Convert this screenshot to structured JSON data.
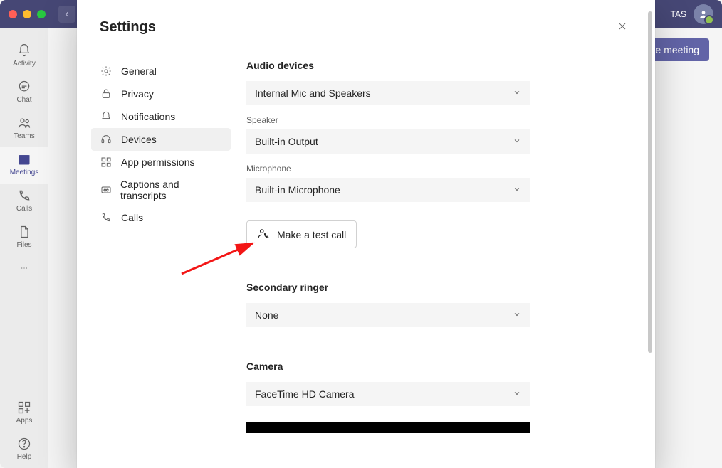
{
  "titlebar": {
    "user_initials": "TAS"
  },
  "leftnav": {
    "items": [
      {
        "label": "Activity"
      },
      {
        "label": "Chat"
      },
      {
        "label": "Teams"
      },
      {
        "label": "Meetings"
      },
      {
        "label": "Calls"
      },
      {
        "label": "Files"
      }
    ],
    "apps_label": "Apps",
    "help_label": "Help"
  },
  "mainbar": {
    "schedule_btn": "Schedule meeting"
  },
  "settings": {
    "title": "Settings",
    "nav": [
      {
        "label": "General"
      },
      {
        "label": "Privacy"
      },
      {
        "label": "Notifications"
      },
      {
        "label": "Devices"
      },
      {
        "label": "App permissions"
      },
      {
        "label": "Captions and transcripts"
      },
      {
        "label": "Calls"
      }
    ],
    "audio_heading": "Audio devices",
    "audio_device_value": "Internal Mic and Speakers",
    "speaker_label": "Speaker",
    "speaker_value": "Built-in Output",
    "mic_label": "Microphone",
    "mic_value": "Built-in Microphone",
    "test_call_btn": "Make a test call",
    "secondary_ringer_heading": "Secondary ringer",
    "secondary_ringer_value": "None",
    "camera_heading": "Camera",
    "camera_value": "FaceTime HD Camera"
  }
}
